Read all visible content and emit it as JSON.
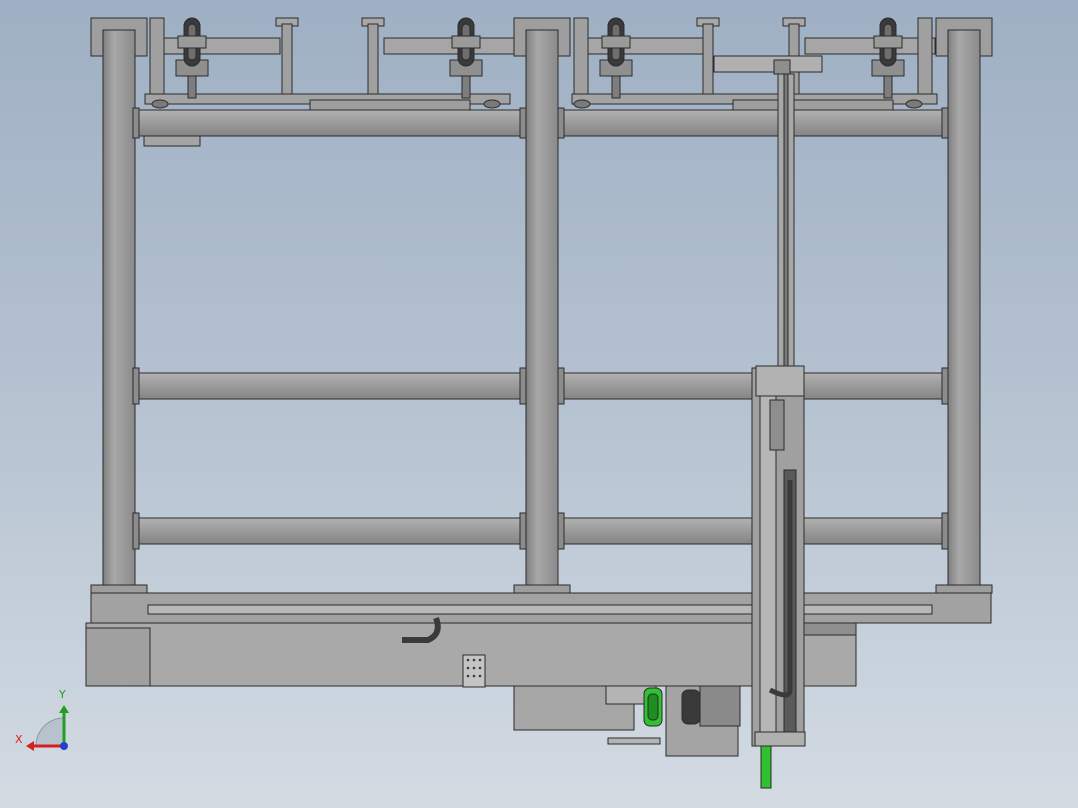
{
  "view": {
    "background_top": "#9fb0c4",
    "background_bottom": "#d3dbe3",
    "frame_color": "#9c9c9c",
    "edge_color": "#2b2b2b",
    "highlight_color": "#30c030"
  },
  "triad": {
    "x_label": "X",
    "y_label": "Y",
    "x_color": "#d62020",
    "y_color": "#20a020",
    "z_color": "#2040d0"
  }
}
